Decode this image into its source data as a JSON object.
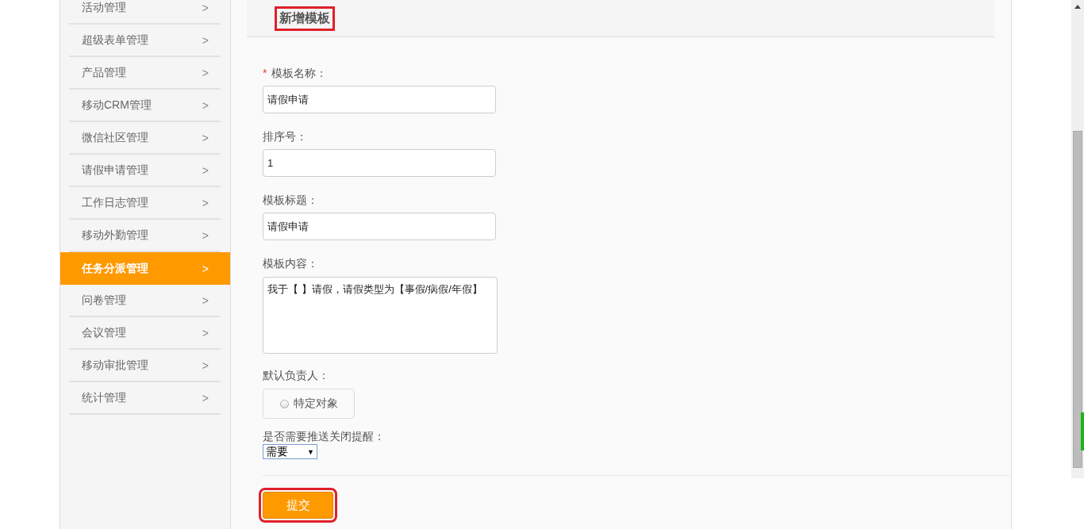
{
  "sidebar": {
    "items": [
      {
        "label": "活动管理",
        "selected": false
      },
      {
        "label": "超级表单管理",
        "selected": false
      },
      {
        "label": "产品管理",
        "selected": false
      },
      {
        "label": "移动CRM管理",
        "selected": false
      },
      {
        "label": "微信社区管理",
        "selected": false
      },
      {
        "label": "请假申请管理",
        "selected": false
      },
      {
        "label": "工作日志管理",
        "selected": false
      },
      {
        "label": "移动外勤管理",
        "selected": false
      },
      {
        "label": "任务分派管理",
        "selected": true
      },
      {
        "label": "问卷管理",
        "selected": false
      },
      {
        "label": "会议管理",
        "selected": false
      },
      {
        "label": "移动审批管理",
        "selected": false
      },
      {
        "label": "统计管理",
        "selected": false
      }
    ],
    "chevron": ">"
  },
  "header": {
    "title": "新增模板",
    "highlighted": true
  },
  "form": {
    "fields": [
      {
        "kind": "text",
        "label": "模板名称：",
        "required": true,
        "required_mark": "*",
        "value": "请假申请"
      },
      {
        "kind": "text",
        "label": "排序号：",
        "required": false,
        "value": "1"
      },
      {
        "kind": "text",
        "label": "模板标题：",
        "required": false,
        "value": "请假申请"
      },
      {
        "kind": "textarea",
        "label": "模板内容：",
        "required": false,
        "value": "我于【 】请假，请假类型为【事假/病假/年假】"
      },
      {
        "kind": "radio",
        "label": "默认负责人：",
        "required": false,
        "option": "特定对象",
        "checked": false
      },
      {
        "kind": "select",
        "label": "是否需要推送关闭提醒：",
        "required": false,
        "value": "需要",
        "arrow": "▼"
      }
    ],
    "submit": {
      "label": "提交",
      "highlighted": true
    }
  }
}
